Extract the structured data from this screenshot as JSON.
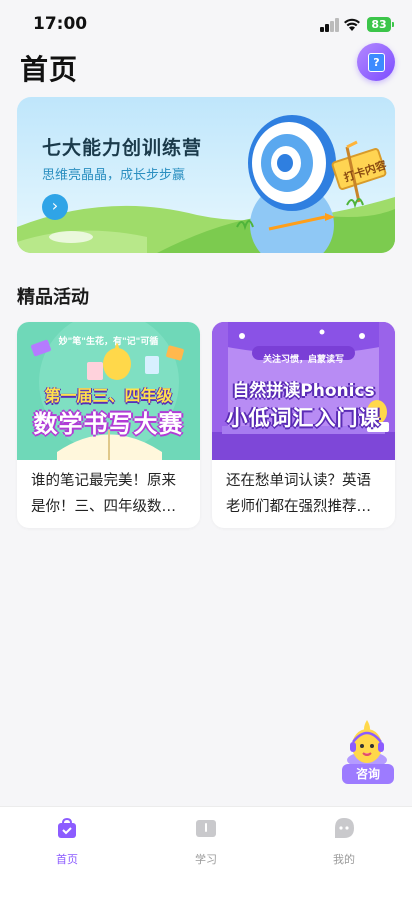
{
  "status_bar": {
    "time": "17:00",
    "battery": "83"
  },
  "header": {
    "title": "首页",
    "help_icon": "question-icon"
  },
  "banner": {
    "title": "七大能力创训练营",
    "subtitle": "思维亮晶晶，成长步步赢",
    "sign_text": "打卡内容",
    "arrow_icon": "chevron-right-icon"
  },
  "section": {
    "title": "精品活动"
  },
  "cards": [
    {
      "image_tag": "妙\"笔\"生花，有\"记\"可循",
      "image_line1": "第一届三、四年级",
      "image_line2": "数学书写大赛",
      "text_line1": "谁的笔记最完美！原来",
      "text_line2": "是你！三、四年级数…"
    },
    {
      "image_tag": "关注习惯，启蒙读写",
      "image_line1": "自然拼读Phonics",
      "image_line2": "小低词汇入门课",
      "text_line1": "还在愁单词认读？英语",
      "text_line2": "老师们都在强烈推荐…"
    }
  ],
  "consult": {
    "label": "咨询"
  },
  "tabs": [
    {
      "label": "首页",
      "icon": "home-bag-icon",
      "active": true
    },
    {
      "label": "学习",
      "icon": "book-icon",
      "active": false
    },
    {
      "label": "我的",
      "icon": "profile-icon",
      "active": false
    }
  ],
  "colors": {
    "accent": "#8c5cff",
    "banner_blue": "#2fa4e7",
    "inactive": "#9a9a9a"
  }
}
